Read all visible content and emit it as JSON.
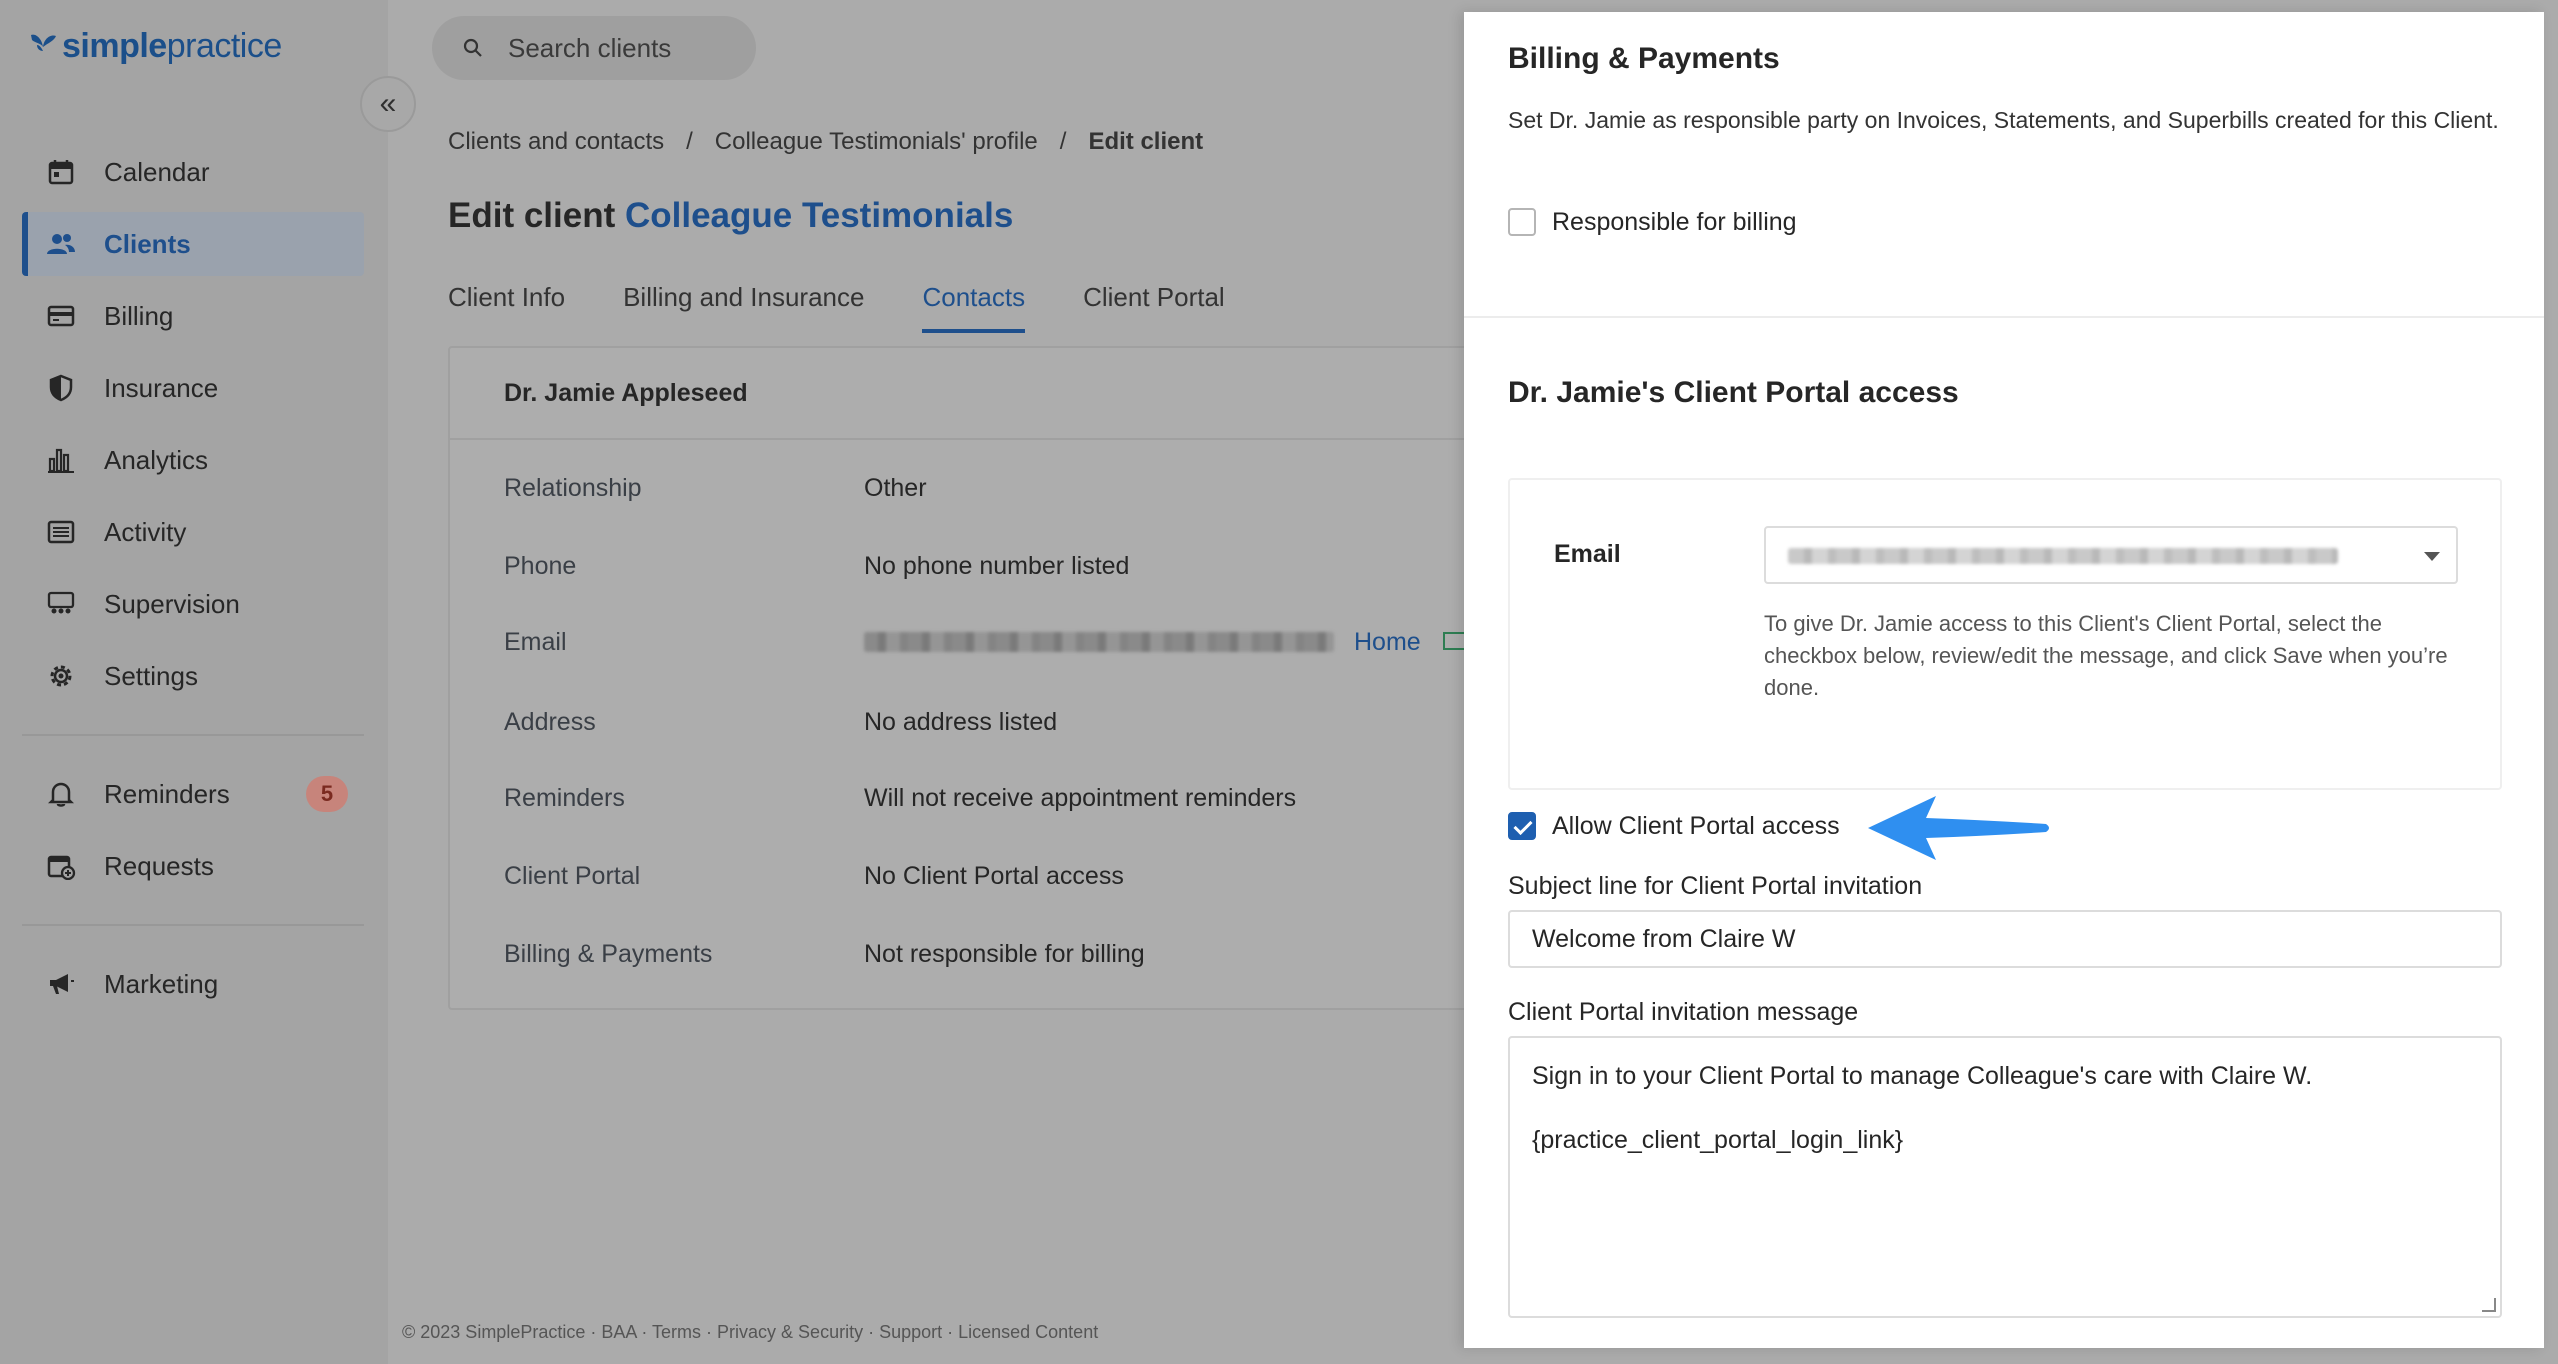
{
  "logo": {
    "text_bold": "simple",
    "text_regular": "practice",
    "icon": "butterfly-icon"
  },
  "sidebar": {
    "items": [
      {
        "label": "Calendar",
        "icon": "calendar-icon",
        "active": false
      },
      {
        "label": "Clients",
        "icon": "users-icon",
        "active": true
      },
      {
        "label": "Billing",
        "icon": "credit-card-icon",
        "active": false
      },
      {
        "label": "Insurance",
        "icon": "shield-icon",
        "active": false
      },
      {
        "label": "Analytics",
        "icon": "bar-chart-icon",
        "active": false
      },
      {
        "label": "Activity",
        "icon": "list-icon",
        "active": false
      },
      {
        "label": "Supervision",
        "icon": "supervision-icon",
        "active": false
      },
      {
        "label": "Settings",
        "icon": "gear-icon",
        "active": false
      }
    ],
    "secondary": [
      {
        "label": "Reminders",
        "icon": "bell-icon",
        "badge": "5"
      },
      {
        "label": "Requests",
        "icon": "calendar-plus-icon"
      }
    ],
    "tertiary": [
      {
        "label": "Marketing",
        "icon": "megaphone-icon"
      }
    ]
  },
  "search": {
    "placeholder": "Search clients"
  },
  "breadcrumb": {
    "items": [
      "Clients and contacts",
      "Colleague Testimonials' profile",
      "Edit client"
    ],
    "separator": "/"
  },
  "page": {
    "title_prefix": "Edit client",
    "client_name": "Colleague Testimonials",
    "tabs": [
      "Client Info",
      "Billing and Insurance",
      "Contacts",
      "Client Portal"
    ],
    "active_tab": "Contacts"
  },
  "contact_card": {
    "name": "Dr. Jamie Appleseed",
    "rows": [
      {
        "key": "Relationship",
        "value": "Other"
      },
      {
        "key": "Phone",
        "value": "No phone number listed"
      },
      {
        "key": "Email",
        "value": "",
        "link": "Home"
      },
      {
        "key": "Address",
        "value": "No address listed"
      },
      {
        "key": "Reminders",
        "value": "Will not receive appointment reminders"
      },
      {
        "key": "Client Portal",
        "value": "No Client Portal access"
      },
      {
        "key": "Billing & Payments",
        "value": "Not responsible for billing"
      }
    ]
  },
  "footer": {
    "text": "© 2023 SimplePractice · BAA · Terms · Privacy & Security · Support · Licensed Content"
  },
  "drawer": {
    "billing": {
      "heading": "Billing & Payments",
      "description": "Set Dr. Jamie as responsible party on Invoices, Statements, and Superbills created for this Client.",
      "checkbox_label": "Responsible for billing",
      "checked": false
    },
    "portal": {
      "heading": "Dr. Jamie's Client Portal access",
      "email_label": "Email",
      "help": "To give Dr. Jamie access to this Client's Client Portal, select the checkbox below, review/edit the message, and click Save when you’re done.",
      "checkbox_label": "Allow Client Portal access",
      "checked": true,
      "subject_label": "Subject line for Client Portal invitation",
      "subject_value": "Welcome from Claire W",
      "message_label": "Client Portal invitation message",
      "message_line1": "Sign in to your Client Portal to manage Colleague's care with Claire W.",
      "message_line2": "{practice_client_portal_login_link}"
    }
  },
  "colors": {
    "accent": "#1e5fb0",
    "arrow": "#2f8ff0",
    "badge": "#c7847b"
  }
}
